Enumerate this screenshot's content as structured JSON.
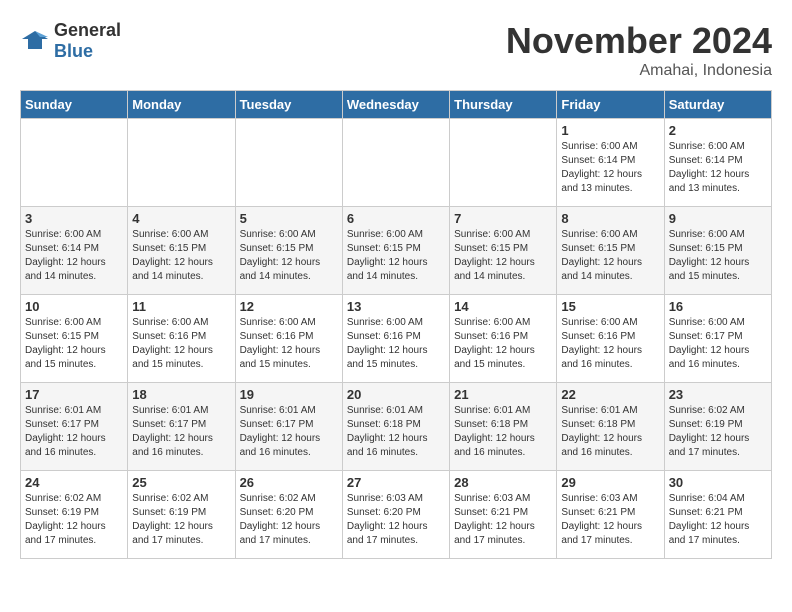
{
  "logo": {
    "general": "General",
    "blue": "Blue"
  },
  "title": {
    "month": "November 2024",
    "location": "Amahai, Indonesia"
  },
  "weekdays": [
    "Sunday",
    "Monday",
    "Tuesday",
    "Wednesday",
    "Thursday",
    "Friday",
    "Saturday"
  ],
  "weeks": [
    [
      {
        "day": "",
        "info": ""
      },
      {
        "day": "",
        "info": ""
      },
      {
        "day": "",
        "info": ""
      },
      {
        "day": "",
        "info": ""
      },
      {
        "day": "",
        "info": ""
      },
      {
        "day": "1",
        "info": "Sunrise: 6:00 AM\nSunset: 6:14 PM\nDaylight: 12 hours\nand 13 minutes."
      },
      {
        "day": "2",
        "info": "Sunrise: 6:00 AM\nSunset: 6:14 PM\nDaylight: 12 hours\nand 13 minutes."
      }
    ],
    [
      {
        "day": "3",
        "info": "Sunrise: 6:00 AM\nSunset: 6:14 PM\nDaylight: 12 hours\nand 14 minutes."
      },
      {
        "day": "4",
        "info": "Sunrise: 6:00 AM\nSunset: 6:15 PM\nDaylight: 12 hours\nand 14 minutes."
      },
      {
        "day": "5",
        "info": "Sunrise: 6:00 AM\nSunset: 6:15 PM\nDaylight: 12 hours\nand 14 minutes."
      },
      {
        "day": "6",
        "info": "Sunrise: 6:00 AM\nSunset: 6:15 PM\nDaylight: 12 hours\nand 14 minutes."
      },
      {
        "day": "7",
        "info": "Sunrise: 6:00 AM\nSunset: 6:15 PM\nDaylight: 12 hours\nand 14 minutes."
      },
      {
        "day": "8",
        "info": "Sunrise: 6:00 AM\nSunset: 6:15 PM\nDaylight: 12 hours\nand 14 minutes."
      },
      {
        "day": "9",
        "info": "Sunrise: 6:00 AM\nSunset: 6:15 PM\nDaylight: 12 hours\nand 15 minutes."
      }
    ],
    [
      {
        "day": "10",
        "info": "Sunrise: 6:00 AM\nSunset: 6:15 PM\nDaylight: 12 hours\nand 15 minutes."
      },
      {
        "day": "11",
        "info": "Sunrise: 6:00 AM\nSunset: 6:16 PM\nDaylight: 12 hours\nand 15 minutes."
      },
      {
        "day": "12",
        "info": "Sunrise: 6:00 AM\nSunset: 6:16 PM\nDaylight: 12 hours\nand 15 minutes."
      },
      {
        "day": "13",
        "info": "Sunrise: 6:00 AM\nSunset: 6:16 PM\nDaylight: 12 hours\nand 15 minutes."
      },
      {
        "day": "14",
        "info": "Sunrise: 6:00 AM\nSunset: 6:16 PM\nDaylight: 12 hours\nand 15 minutes."
      },
      {
        "day": "15",
        "info": "Sunrise: 6:00 AM\nSunset: 6:16 PM\nDaylight: 12 hours\nand 16 minutes."
      },
      {
        "day": "16",
        "info": "Sunrise: 6:00 AM\nSunset: 6:17 PM\nDaylight: 12 hours\nand 16 minutes."
      }
    ],
    [
      {
        "day": "17",
        "info": "Sunrise: 6:01 AM\nSunset: 6:17 PM\nDaylight: 12 hours\nand 16 minutes."
      },
      {
        "day": "18",
        "info": "Sunrise: 6:01 AM\nSunset: 6:17 PM\nDaylight: 12 hours\nand 16 minutes."
      },
      {
        "day": "19",
        "info": "Sunrise: 6:01 AM\nSunset: 6:17 PM\nDaylight: 12 hours\nand 16 minutes."
      },
      {
        "day": "20",
        "info": "Sunrise: 6:01 AM\nSunset: 6:18 PM\nDaylight: 12 hours\nand 16 minutes."
      },
      {
        "day": "21",
        "info": "Sunrise: 6:01 AM\nSunset: 6:18 PM\nDaylight: 12 hours\nand 16 minutes."
      },
      {
        "day": "22",
        "info": "Sunrise: 6:01 AM\nSunset: 6:18 PM\nDaylight: 12 hours\nand 16 minutes."
      },
      {
        "day": "23",
        "info": "Sunrise: 6:02 AM\nSunset: 6:19 PM\nDaylight: 12 hours\nand 17 minutes."
      }
    ],
    [
      {
        "day": "24",
        "info": "Sunrise: 6:02 AM\nSunset: 6:19 PM\nDaylight: 12 hours\nand 17 minutes."
      },
      {
        "day": "25",
        "info": "Sunrise: 6:02 AM\nSunset: 6:19 PM\nDaylight: 12 hours\nand 17 minutes."
      },
      {
        "day": "26",
        "info": "Sunrise: 6:02 AM\nSunset: 6:20 PM\nDaylight: 12 hours\nand 17 minutes."
      },
      {
        "day": "27",
        "info": "Sunrise: 6:03 AM\nSunset: 6:20 PM\nDaylight: 12 hours\nand 17 minutes."
      },
      {
        "day": "28",
        "info": "Sunrise: 6:03 AM\nSunset: 6:21 PM\nDaylight: 12 hours\nand 17 minutes."
      },
      {
        "day": "29",
        "info": "Sunrise: 6:03 AM\nSunset: 6:21 PM\nDaylight: 12 hours\nand 17 minutes."
      },
      {
        "day": "30",
        "info": "Sunrise: 6:04 AM\nSunset: 6:21 PM\nDaylight: 12 hours\nand 17 minutes."
      }
    ]
  ]
}
